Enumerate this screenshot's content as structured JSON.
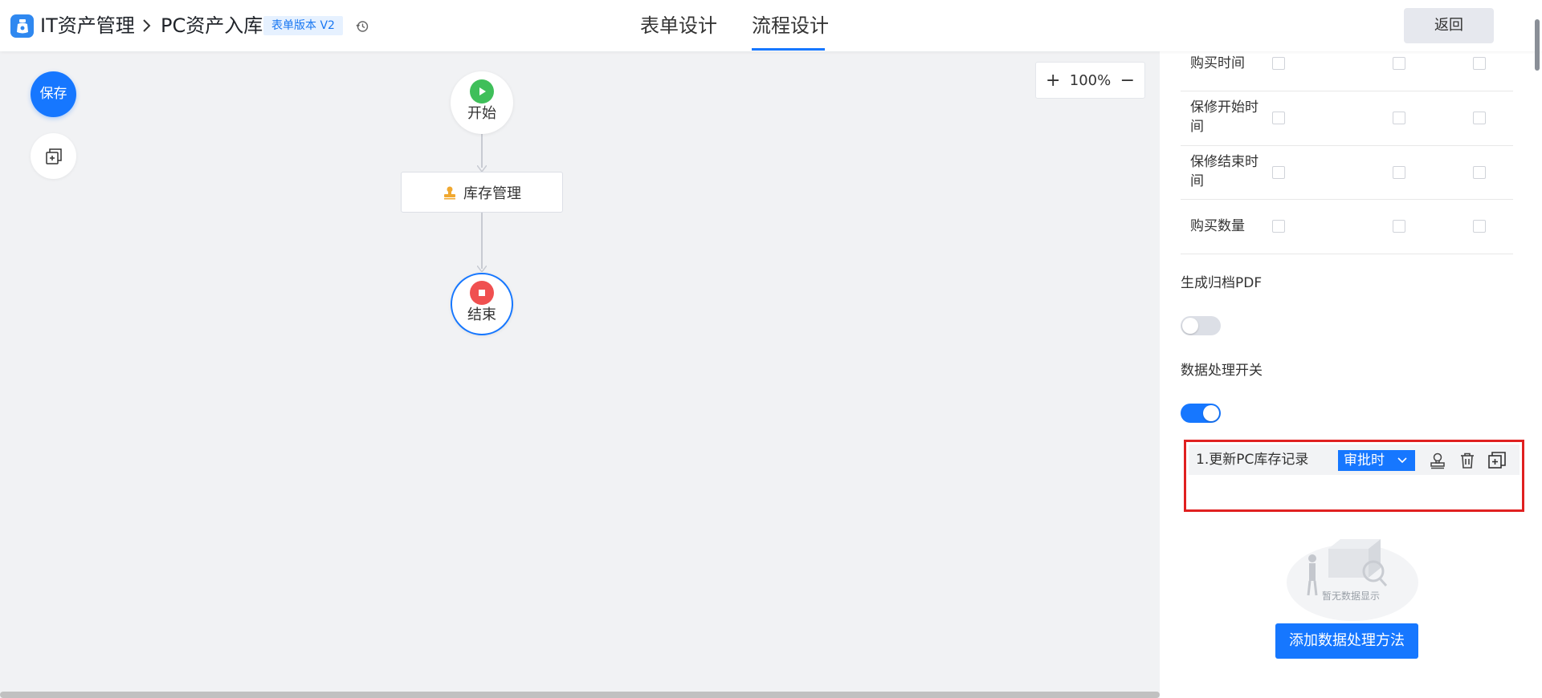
{
  "header": {
    "app_name": "IT资产管理",
    "page_name": "PC资产入库",
    "version_tag": "表单版本 V2",
    "tabs": [
      {
        "label": "表单设计",
        "active": false
      },
      {
        "label": "流程设计",
        "active": true
      }
    ],
    "back_label": "返回"
  },
  "toolbar": {
    "save_label": "保存"
  },
  "canvas": {
    "start_label": "开始",
    "task_label": "库存管理",
    "end_label": "结束",
    "zoom_level": "100%",
    "zoom_in": "+",
    "zoom_out": "−"
  },
  "panel": {
    "permission_rows": [
      {
        "label": "购买时间"
      },
      {
        "label": "保修开始时间"
      },
      {
        "label": "保修结束时间"
      },
      {
        "label": "购买数量"
      }
    ],
    "archive_pdf_label": "生成归档PDF",
    "archive_pdf_enabled": false,
    "data_processing_label": "数据处理开关",
    "data_processing_enabled": true,
    "method": {
      "name": "1.更新PC库存记录",
      "trigger": "审批时"
    },
    "empty_text": "暂无数据显示",
    "add_method_label": "添加数据处理方法"
  },
  "colors": {
    "primary": "#1677ff",
    "start_node": "#3fbf5a",
    "end_node": "#f05050",
    "highlight_border": "#e02020"
  }
}
